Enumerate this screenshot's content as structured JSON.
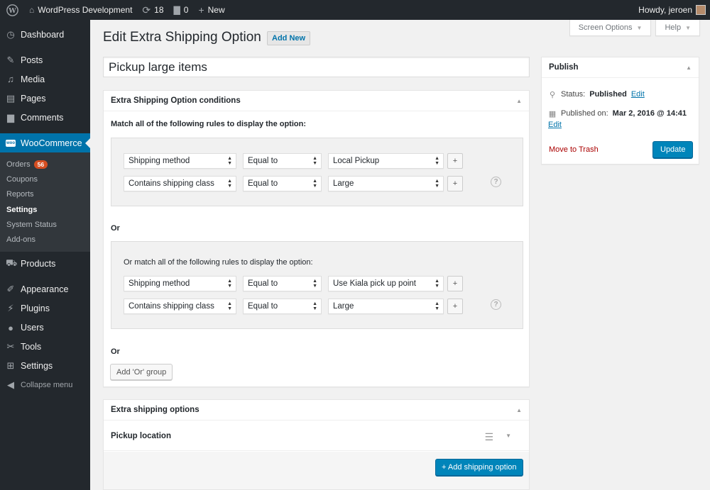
{
  "adminbar": {
    "site_name": "WordPress Development",
    "updates_count": "18",
    "comments_count": "0",
    "new_label": "New",
    "greeting": "Howdy, jeroen"
  },
  "sidebar": {
    "dashboard": "Dashboard",
    "posts": "Posts",
    "media": "Media",
    "pages": "Pages",
    "comments": "Comments",
    "woocommerce": "WooCommerce",
    "woo_icon_text": "woo",
    "submenu": {
      "orders": "Orders",
      "orders_badge": "56",
      "coupons": "Coupons",
      "reports": "Reports",
      "settings": "Settings",
      "system_status": "System Status",
      "addons": "Add-ons"
    },
    "products": "Products",
    "appearance": "Appearance",
    "plugins": "Plugins",
    "users": "Users",
    "tools": "Tools",
    "settings": "Settings",
    "collapse": "Collapse menu"
  },
  "screen_tabs": {
    "screen_options": "Screen Options",
    "help": "Help"
  },
  "page": {
    "title": "Edit Extra Shipping Option",
    "add_new": "Add New",
    "post_title": "Pickup large items"
  },
  "conditions": {
    "header": "Extra Shipping Option conditions",
    "intro": "Match all of the following rules to display the option:",
    "group1": {
      "rows": [
        {
          "field": "Shipping method",
          "operator": "Equal to",
          "value": "Local Pickup"
        },
        {
          "field": "Contains shipping class",
          "operator": "Equal to",
          "value": "Large"
        }
      ]
    },
    "or_label": "Or",
    "group2": {
      "intro": "Or match all of the following rules to display the option:",
      "rows": [
        {
          "field": "Shipping method",
          "operator": "Equal to",
          "value": "Use Kiala pick up point"
        },
        {
          "field": "Contains shipping class",
          "operator": "Equal to",
          "value": "Large"
        }
      ]
    },
    "or_label2": "Or",
    "add_or_group": "Add 'Or' group",
    "plus": "+",
    "help": "?"
  },
  "shipping_options": {
    "header": "Extra shipping options",
    "option_name": "Pickup location",
    "add_button": "+ Add shipping option"
  },
  "publish": {
    "header": "Publish",
    "status_label": "Status:",
    "status_value": "Published",
    "edit": "Edit",
    "published_on_label": "Published on:",
    "published_on_value": "Mar 2, 2016 @ 14:41",
    "edit2": "Edit",
    "move_to_trash": "Move to Trash",
    "update": "Update"
  }
}
